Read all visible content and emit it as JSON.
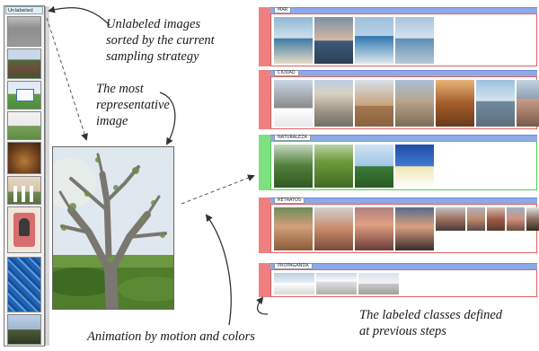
{
  "annotations": {
    "unlabeled": [
      "Unlabeled images",
      "sorted by the current",
      "sampling strategy"
    ],
    "representative": [
      "The most",
      "representative",
      "image"
    ],
    "animation": "Animation by motion and colors",
    "labeled": [
      "The labeled classes defined",
      "at previous steps"
    ]
  },
  "strip": {
    "label": "Unlabeled"
  },
  "classes": [
    {
      "name": "MAR",
      "marker_color": "#f08080",
      "header_color": "#8fa9e8",
      "border_color": "#e06060",
      "count": 4
    },
    {
      "name": "CIUDAD",
      "marker_color": "#f08080",
      "header_color": "#8fa9e8",
      "border_color": "#e06060",
      "count": 7
    },
    {
      "name": "NATURALEZA",
      "marker_color": "#7fe07f",
      "header_color": "#8fa9e8",
      "border_color": "#55cc55",
      "count": 4
    },
    {
      "name": "RETRATOS",
      "marker_color": "#f08080",
      "header_color": "#8fa9e8",
      "border_color": "#e06060",
      "count": 9
    },
    {
      "name": "PROPAGANDA",
      "marker_color": "#f08080",
      "header_color": "#8fa9e8",
      "border_color": "#e06060",
      "count": 3
    }
  ],
  "colors": {
    "red_marker": "#f08080",
    "green_marker": "#7fe07f",
    "header_blue": "#8fa9e8",
    "arrow": "#333333"
  }
}
